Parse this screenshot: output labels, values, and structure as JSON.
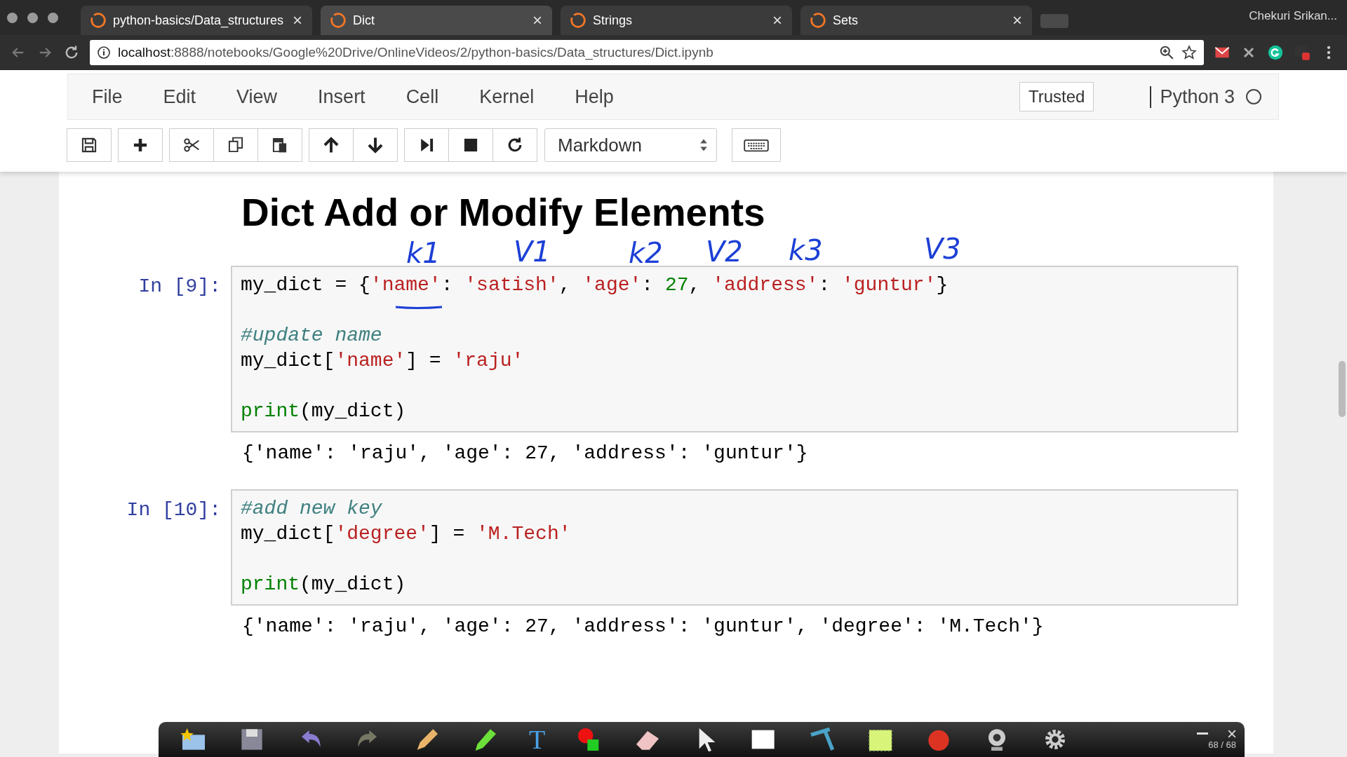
{
  "browser": {
    "tabs": [
      {
        "title": "python-basics/Data_structures",
        "close": "×",
        "selected": false
      },
      {
        "title": "Dict",
        "close": "×",
        "selected": true
      },
      {
        "title": "Strings",
        "close": "×",
        "selected": false
      },
      {
        "title": "Sets",
        "close": "×",
        "selected": false
      }
    ],
    "profile": "Chekuri Srikan...",
    "url_host": "localhost",
    "url_rest": ":8888/notebooks/Google%20Drive/OnlineVideos/2/python-basics/Data_structures/Dict.ipynb"
  },
  "menu": [
    "File",
    "Edit",
    "View",
    "Insert",
    "Cell",
    "Kernel",
    "Help"
  ],
  "trusted": "Trusted",
  "kernel": "Python 3",
  "cell_type": "Markdown",
  "heading": "Dict Add or Modify Elements",
  "annotations": [
    "k1",
    "V1",
    "k2",
    "V2",
    "k3",
    "V3"
  ],
  "cells": [
    {
      "prompt": "In [9]:",
      "lines": [
        {
          "kind": "code",
          "tokens": [
            {
              "kind": "plain",
              "text": "my_dict = {"
            },
            {
              "kind": "string",
              "text": "'name'"
            },
            {
              "kind": "plain",
              "text": ": "
            },
            {
              "kind": "string",
              "text": "'satish'"
            },
            {
              "kind": "plain",
              "text": ", "
            },
            {
              "kind": "string",
              "text": "'age'"
            },
            {
              "kind": "plain",
              "text": ": "
            },
            {
              "kind": "number",
              "text": "27"
            },
            {
              "kind": "plain",
              "text": ", "
            },
            {
              "kind": "string",
              "text": "'address'"
            },
            {
              "kind": "plain",
              "text": ": "
            },
            {
              "kind": "string",
              "text": "'guntur'"
            },
            {
              "kind": "plain",
              "text": "}"
            }
          ]
        },
        {
          "kind": "blank"
        },
        {
          "kind": "code",
          "tokens": [
            {
              "kind": "comment",
              "text": "#update name"
            }
          ]
        },
        {
          "kind": "code",
          "tokens": [
            {
              "kind": "plain",
              "text": "my_dict["
            },
            {
              "kind": "string",
              "text": "'name'"
            },
            {
              "kind": "plain",
              "text": "] = "
            },
            {
              "kind": "string",
              "text": "'raju'"
            }
          ]
        },
        {
          "kind": "blank"
        },
        {
          "kind": "code",
          "tokens": [
            {
              "kind": "builtin",
              "text": "print"
            },
            {
              "kind": "plain",
              "text": "(my_dict)"
            }
          ]
        }
      ],
      "output": "{'name': 'raju', 'age': 27, 'address': 'guntur'}"
    },
    {
      "prompt": "In [10]:",
      "lines": [
        {
          "kind": "code",
          "tokens": [
            {
              "kind": "comment",
              "text": "#add new key"
            }
          ]
        },
        {
          "kind": "code",
          "tokens": [
            {
              "kind": "plain",
              "text": "my_dict["
            },
            {
              "kind": "string",
              "text": "'degree'"
            },
            {
              "kind": "plain",
              "text": "] = "
            },
            {
              "kind": "string",
              "text": "'M.Tech'"
            }
          ]
        },
        {
          "kind": "blank"
        },
        {
          "kind": "code",
          "tokens": [
            {
              "kind": "builtin",
              "text": "print"
            },
            {
              "kind": "plain",
              "text": "(my_dict)"
            }
          ]
        }
      ],
      "output": "{'name': 'raju', 'age': 27, 'address': 'guntur', 'degree': 'M.Tech'}"
    }
  ],
  "text_tool": "T",
  "page_counter": "68 / 68"
}
